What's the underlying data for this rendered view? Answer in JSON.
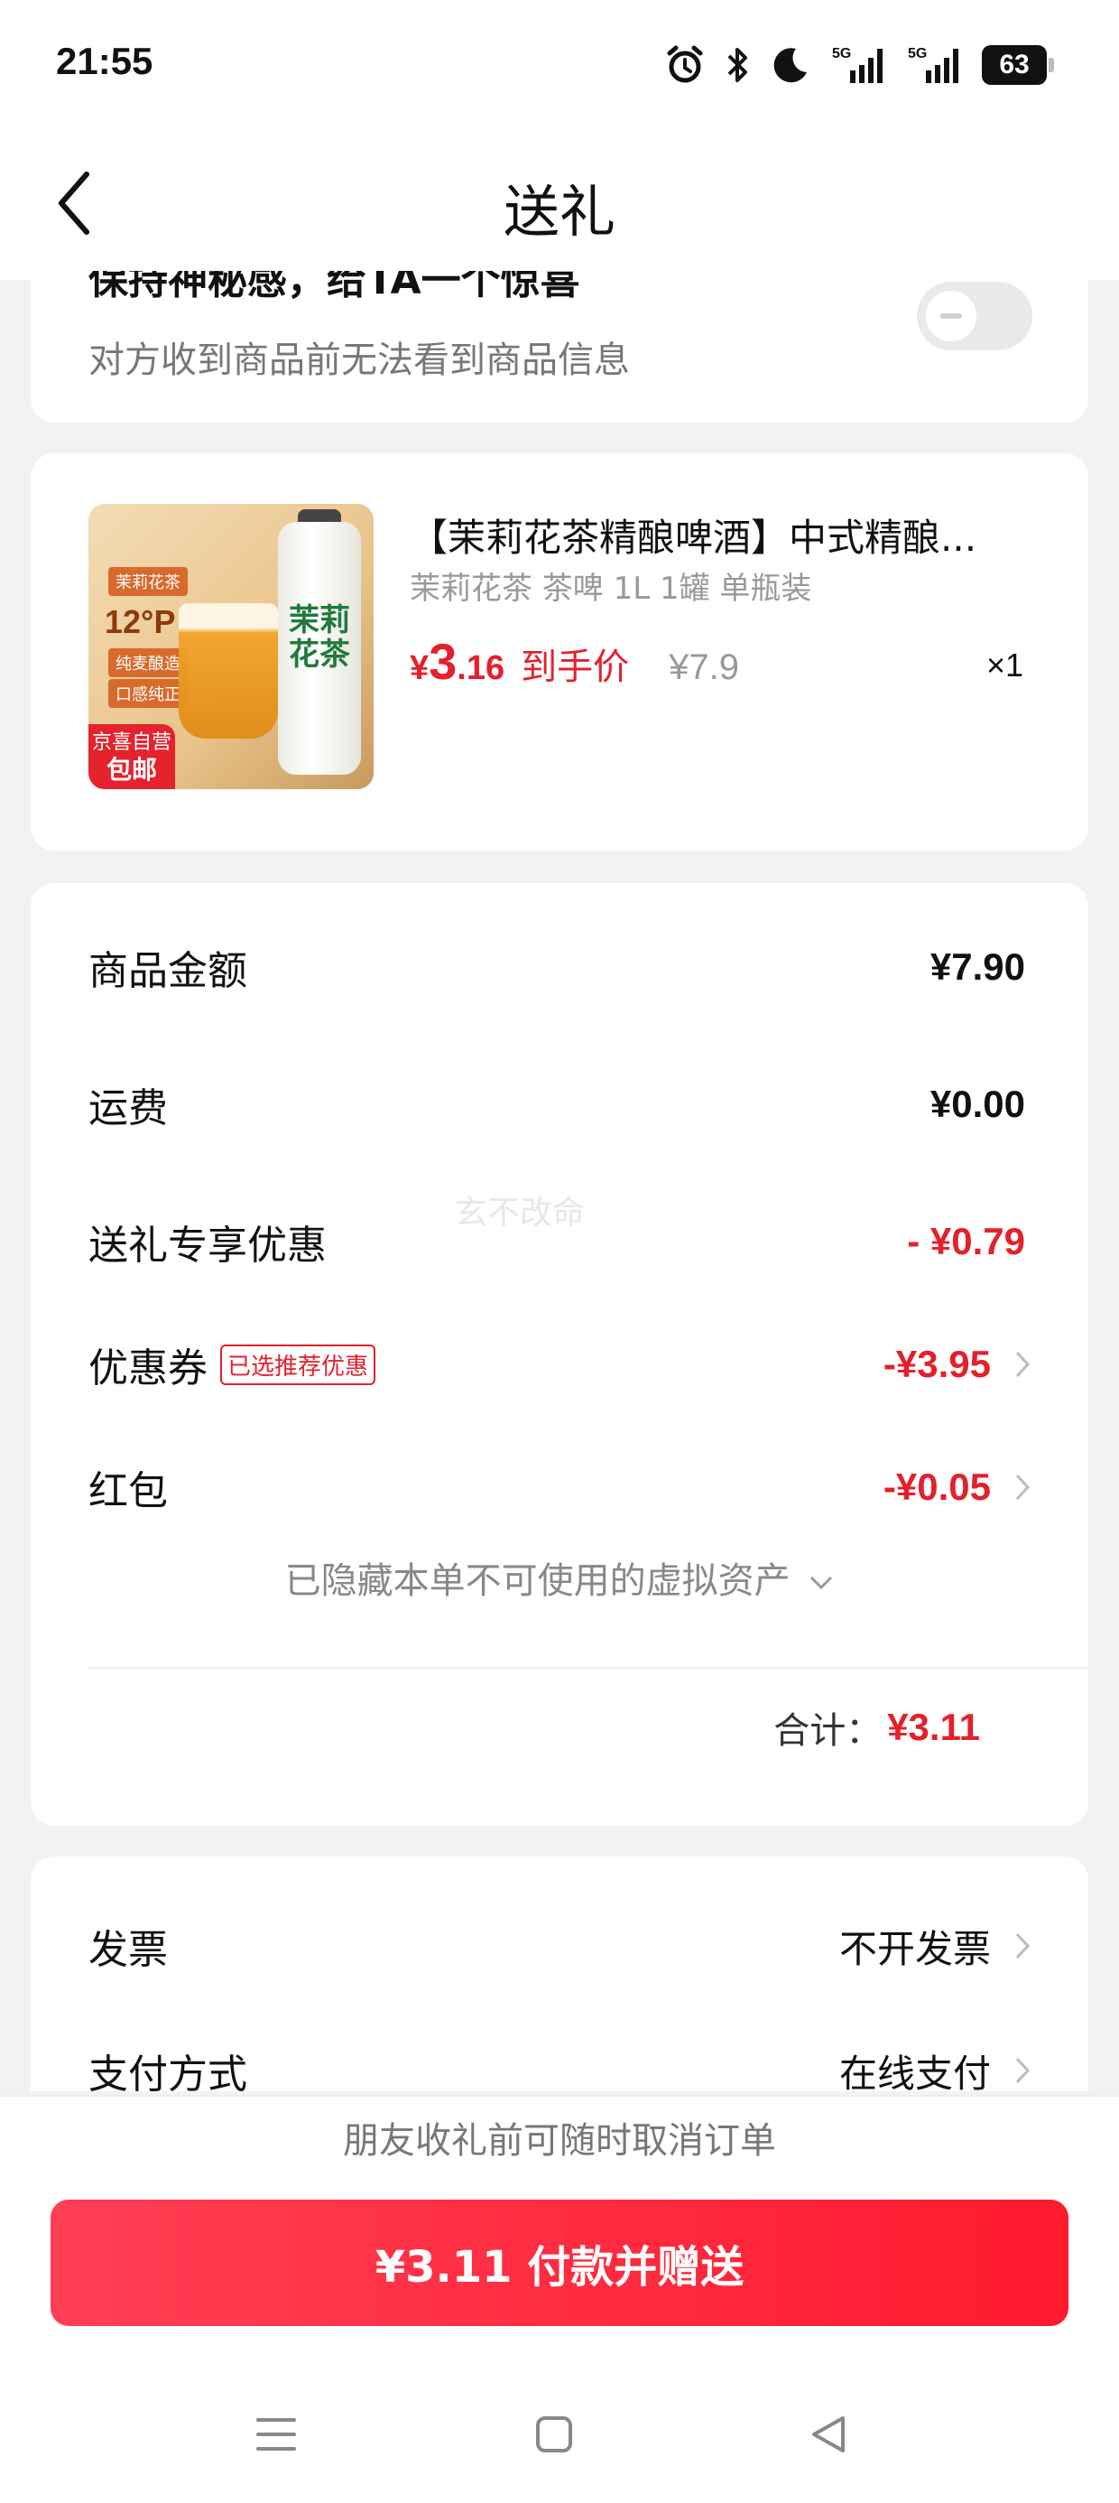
{
  "status_bar": {
    "time": "21:55",
    "icons": [
      "alarm-icon",
      "bluetooth-icon",
      "moon-icon",
      "5g-signal-icon",
      "5g-signal-icon"
    ],
    "network_label_1": "5G",
    "network_label_2": "5G",
    "battery": "63"
  },
  "nav": {
    "title": "送礼",
    "back_icon": "chevron-left-icon"
  },
  "secret": {
    "title": "保持神秘感，给TA一个惊喜",
    "subtitle": "对方收到商品前无法看到商品信息",
    "toggle_on": false
  },
  "product": {
    "title": "【茉莉花茶精酿啤酒】中式精酿...",
    "spec": "茉莉花茶 茶啤 1L 1罐 单瓶装",
    "price_symbol": "¥",
    "price_int": "3",
    "price_dec": ".16",
    "price_label": "到手价",
    "original_price": "¥7.9",
    "quantity": "×1",
    "image": {
      "tag_top": "茉莉花茶",
      "degree": "12°P",
      "tag_a": "纯麦酿造",
      "tag_b": "口感纯正",
      "can_text": "茉莉花茶",
      "badge_line1": "京喜自营",
      "badge_line2": "包邮"
    }
  },
  "costs": {
    "goods_amount": {
      "label": "商品金额",
      "value": "¥7.90"
    },
    "shipping": {
      "label": "运费",
      "value": "¥0.00"
    },
    "gift_discount": {
      "label": "送礼专享优惠",
      "value": "- ¥0.79"
    },
    "coupon": {
      "label": "优惠券",
      "tag": "已选推荐优惠",
      "value": "-¥3.95"
    },
    "red_packet": {
      "label": "红包",
      "value": "-¥0.05"
    },
    "hidden_note": "已隐藏本单不可使用的虚拟资产",
    "total_label": "合计：",
    "total_value": "¥3.11"
  },
  "watermark": "玄不改命",
  "invoice": {
    "invoice": {
      "label": "发票",
      "value": "不开发票"
    },
    "payment": {
      "label": "支付方式",
      "value": "在线支付"
    }
  },
  "footer": {
    "cancel_note": "朋友收礼前可随时取消订单",
    "pay_button": "¥3.11 付款并赠送"
  },
  "colors": {
    "accent_red": "#e4202b",
    "button_gradient_start": "#ff3f55",
    "button_gradient_end": "#ff1a2e",
    "background": "#f2f2f2"
  },
  "system_nav": [
    "menu-icon",
    "home-square-icon",
    "back-triangle-icon"
  ]
}
